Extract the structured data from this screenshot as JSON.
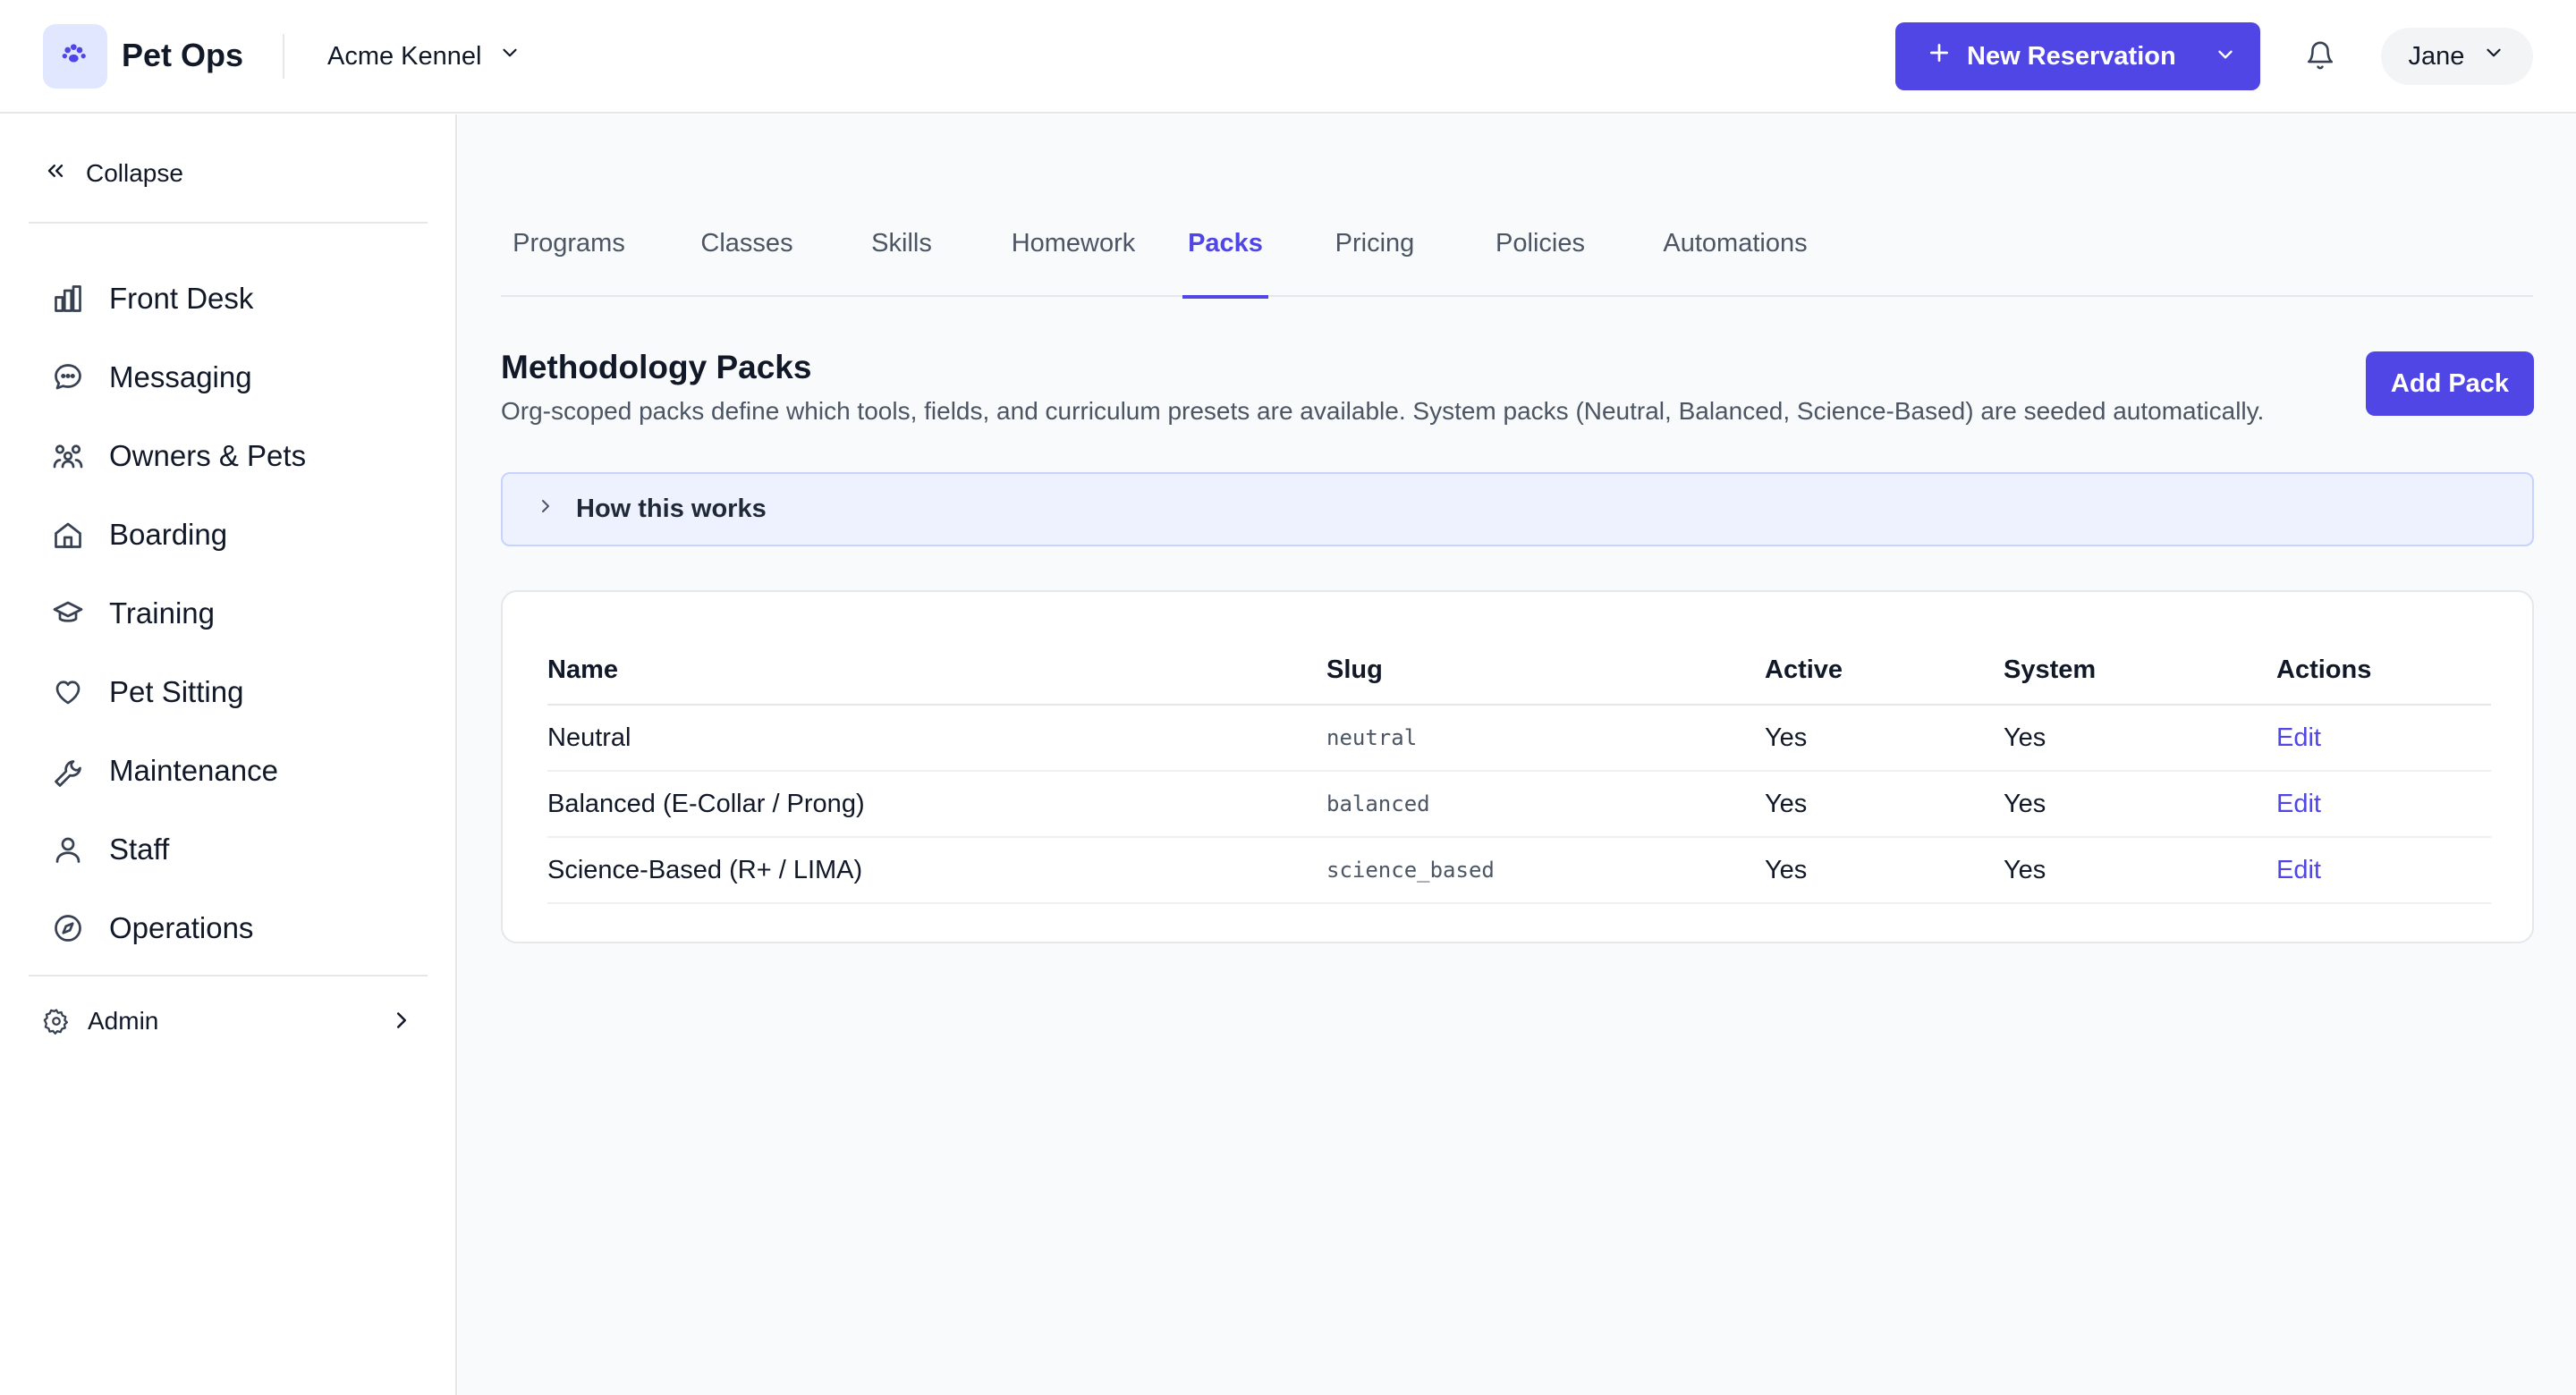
{
  "header": {
    "app_name": "Pet Ops",
    "org_name": "Acme Kennel",
    "new_reservation_label": "New Reservation",
    "user_name": "Jane",
    "colors": {
      "accent": "#4f46e5",
      "logo_bg": "#e0e7ff"
    },
    "icons": [
      "paw-icon",
      "chevron-down-icon",
      "plus-icon",
      "bell-icon"
    ]
  },
  "sidebar": {
    "collapse_label": "Collapse",
    "items": [
      {
        "label": "Front Desk",
        "icon": "front-desk-icon"
      },
      {
        "label": "Messaging",
        "icon": "chat-bubble-icon"
      },
      {
        "label": "Owners & Pets",
        "icon": "users-icon"
      },
      {
        "label": "Boarding",
        "icon": "home-icon"
      },
      {
        "label": "Training",
        "icon": "graduation-cap-icon"
      },
      {
        "label": "Pet Sitting",
        "icon": "heart-icon"
      },
      {
        "label": "Maintenance",
        "icon": "wrench-icon"
      },
      {
        "label": "Staff",
        "icon": "user-icon"
      },
      {
        "label": "Operations",
        "icon": "compass-icon"
      }
    ],
    "admin_label": "Admin"
  },
  "main": {
    "tabs": [
      {
        "label": "Programs"
      },
      {
        "label": "Classes"
      },
      {
        "label": "Skills"
      },
      {
        "label": "Homework"
      },
      {
        "label": "Packs",
        "active": true
      },
      {
        "label": "Pricing"
      },
      {
        "label": "Policies"
      },
      {
        "label": "Automations"
      }
    ],
    "title": "Methodology Packs",
    "description": "Org-scoped packs define which tools, fields, and curriculum presets are available. System packs (Neutral, Balanced, Science-Based) are seeded automatically.",
    "add_button_label": "Add Pack",
    "how_label": "How this works",
    "table": {
      "columns": [
        "Name",
        "Slug",
        "Active",
        "System",
        "Actions"
      ],
      "rows": [
        {
          "name": "Neutral",
          "slug": "neutral",
          "active": "Yes",
          "system": "Yes",
          "action": "Edit"
        },
        {
          "name": "Balanced (E-Collar / Prong)",
          "slug": "balanced",
          "active": "Yes",
          "system": "Yes",
          "action": "Edit"
        },
        {
          "name": "Science-Based (R+ / LIMA)",
          "slug": "science_based",
          "active": "Yes",
          "system": "Yes",
          "action": "Edit"
        }
      ]
    }
  }
}
